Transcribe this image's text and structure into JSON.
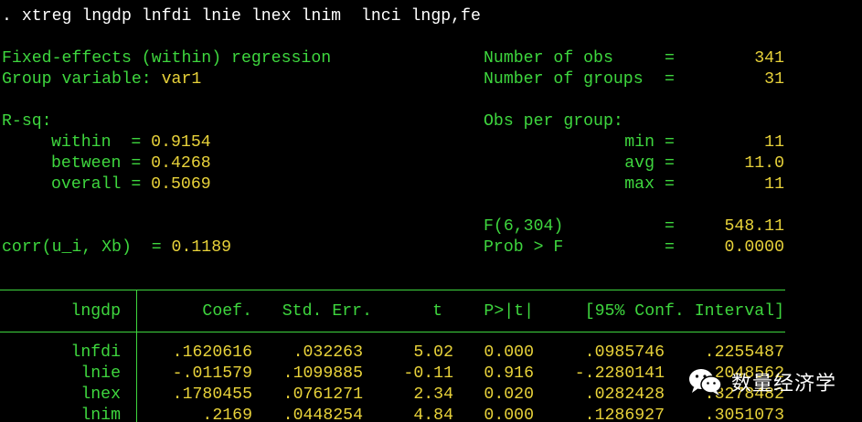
{
  "command": ". xtreg lngdp lnfdi lnie lnex lnim  lnci lngp,fe",
  "header_left": {
    "title": "Fixed-effects (within) regression",
    "group_label": "Group variable: ",
    "group_value": "var1",
    "rsq_label": "R-sq:",
    "within_label": "within  = ",
    "within_value": "0.9154",
    "between_label": "between = ",
    "between_value": "0.4268",
    "overall_label": "overall = ",
    "overall_value": "0.5069",
    "corr_label": "corr(u_i, Xb)  = ",
    "corr_value": "0.1189"
  },
  "header_right": {
    "nobs_label": "Number of obs",
    "nobs_value": "341",
    "ngroups_label": "Number of groups",
    "ngroups_value": "31",
    "eq": "=",
    "obs_per_group": "Obs per group:",
    "min_label": "min",
    "min_value": "11",
    "avg_label": "avg",
    "avg_value": "11.0",
    "max_label": "max",
    "max_value": "11",
    "f_label": "F(6,304)",
    "f_value": "548.11",
    "prob_label": "Prob > F",
    "prob_value": "0.0000"
  },
  "table": {
    "dep_var": "lngdp",
    "columns": [
      "Coef.",
      "Std. Err.",
      "t",
      "P>|t|",
      "[95% Conf. Interval]"
    ],
    "rows": [
      {
        "var": "lnfdi",
        "coef": ".1620616",
        "se": ".032263",
        "t": "5.02",
        "p": "0.000",
        "lo": ".0985746",
        "hi": ".2255487"
      },
      {
        "var": "lnie",
        "coef": "-.011579",
        "se": ".1099885",
        "t": "-0.11",
        "p": "0.916",
        "lo": "-.2280141",
        "hi": ".2048562"
      },
      {
        "var": "lnex",
        "coef": ".1780455",
        "se": ".0761271",
        "t": "2.34",
        "p": "0.020",
        "lo": ".0282428",
        "hi": ".3278482"
      },
      {
        "var": "lnim",
        "coef": ".2169",
        "se": ".0448254",
        "t": "4.84",
        "p": "0.000",
        "lo": ".1286927",
        "hi": ".3051073"
      }
    ]
  },
  "watermark": {
    "icon": "wechat-icon",
    "text": "数量经济学"
  }
}
